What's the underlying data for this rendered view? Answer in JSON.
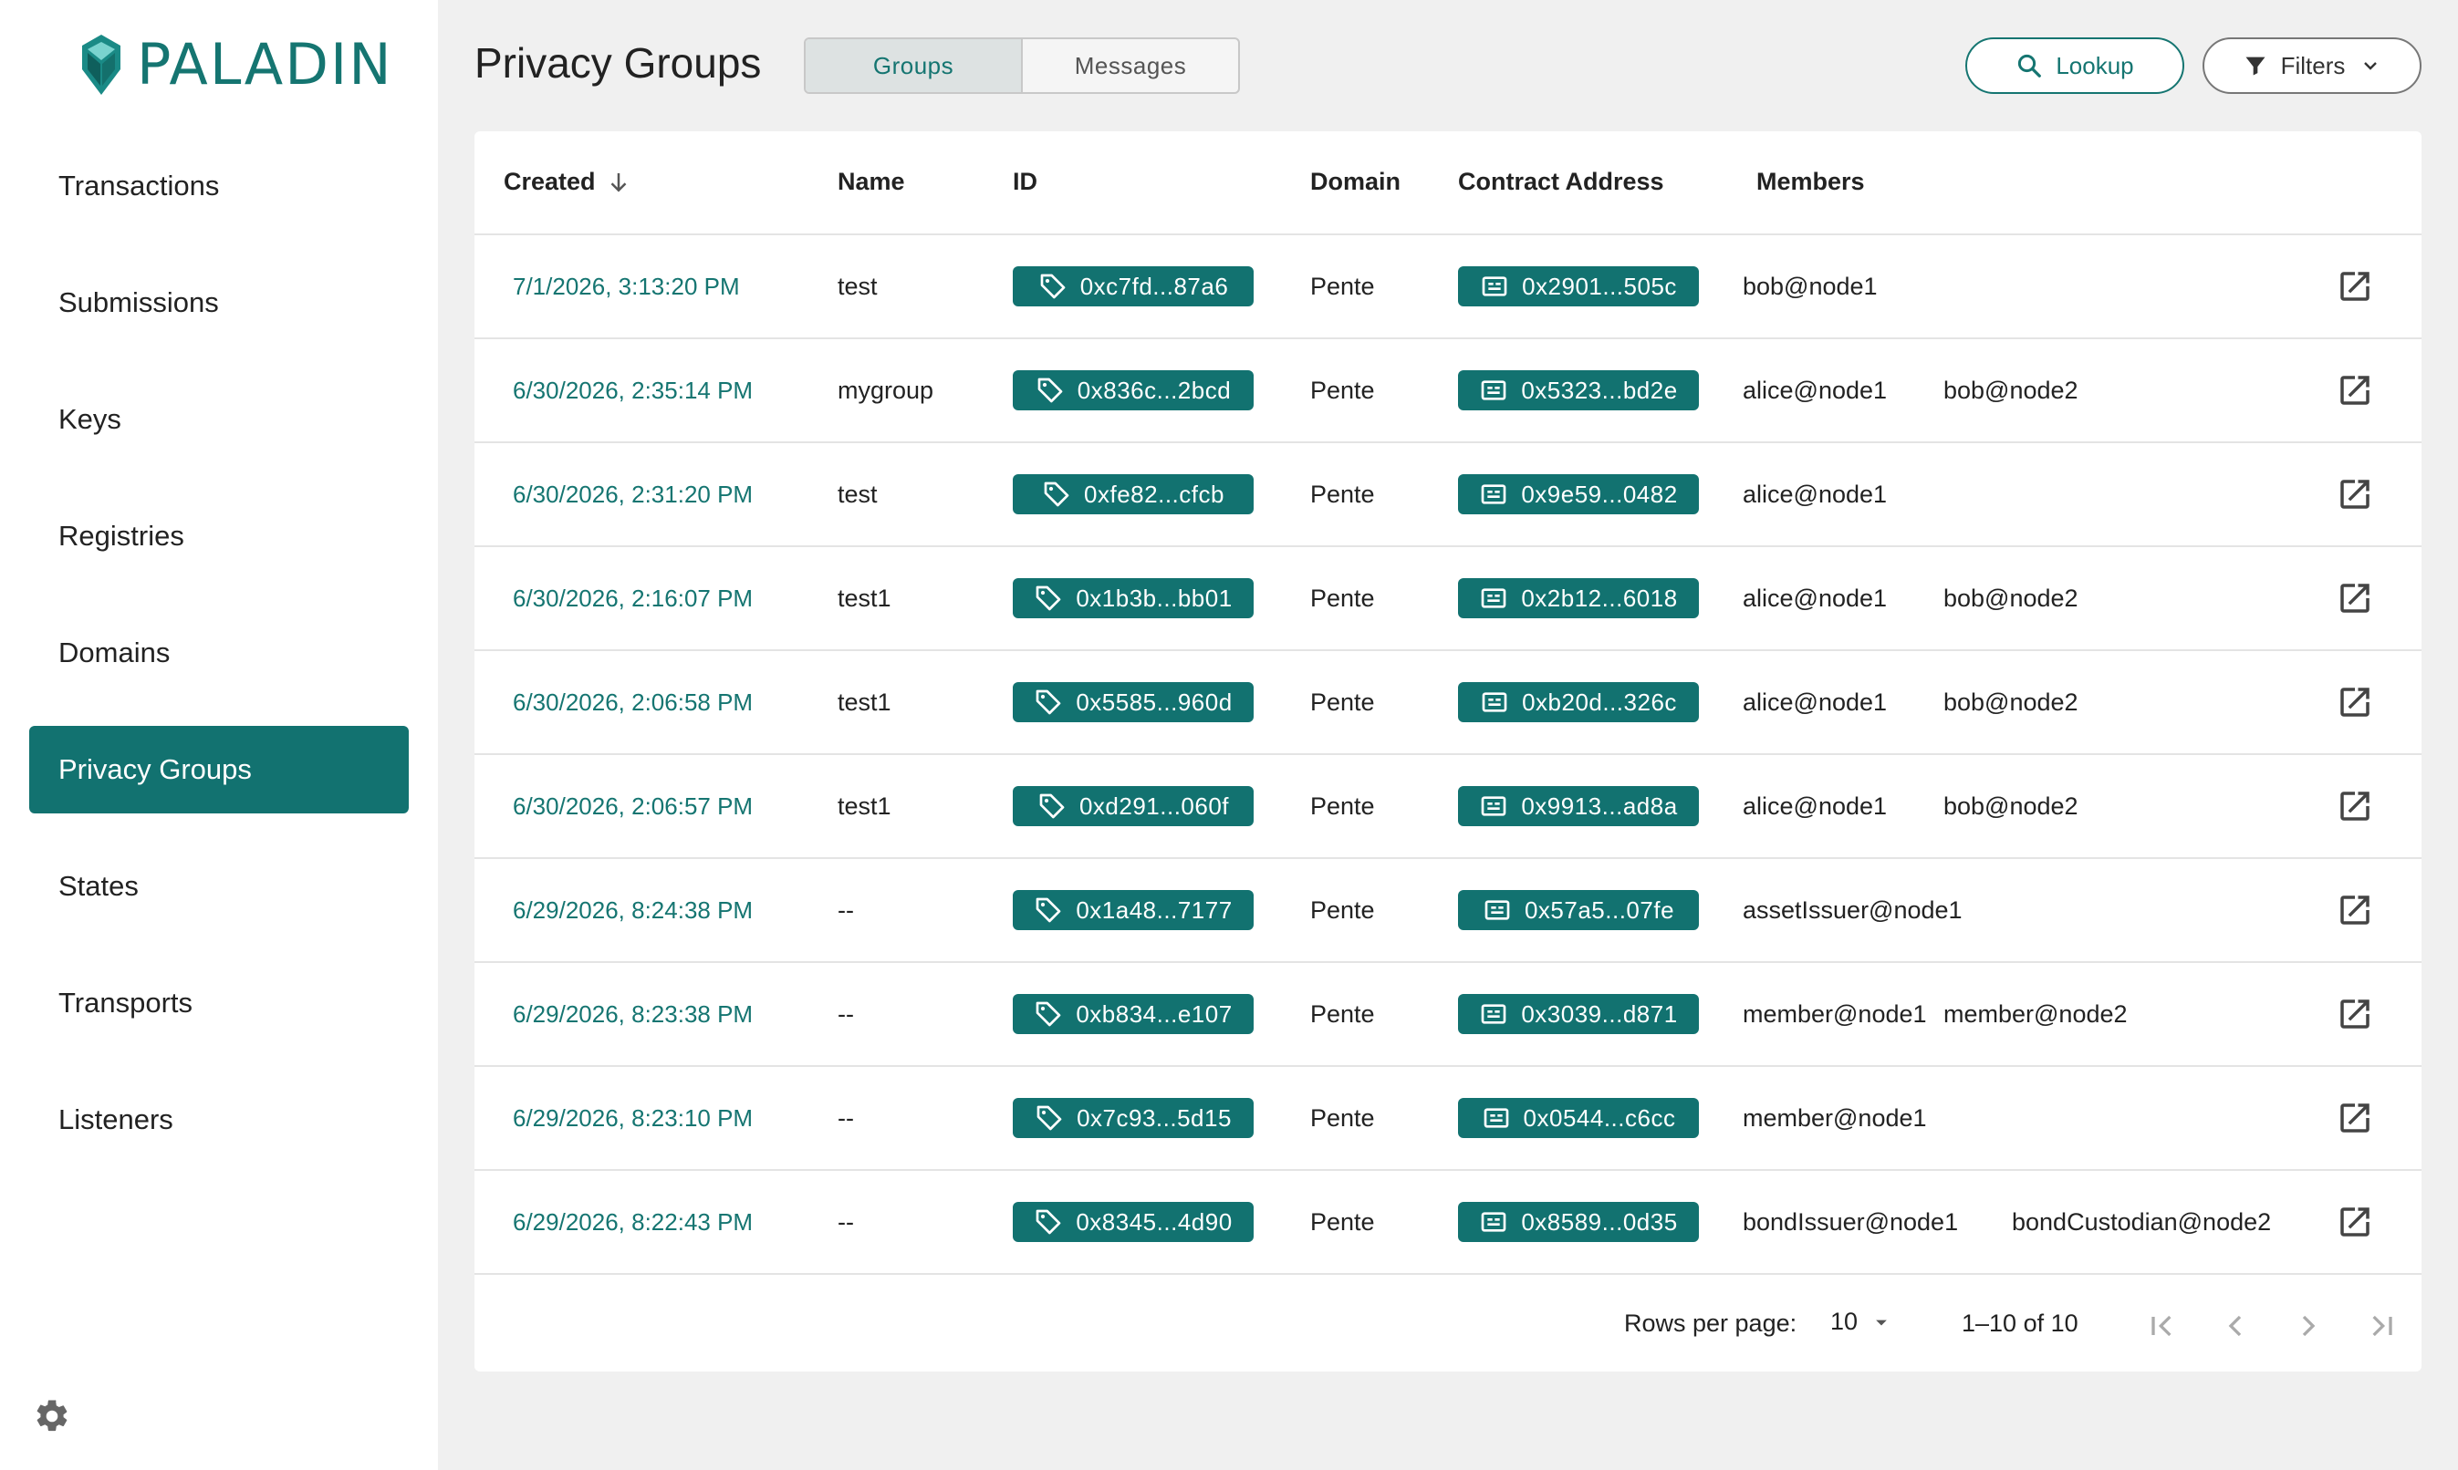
{
  "app": {
    "logo_text": "PALADIN",
    "accent": "#127270"
  },
  "sidebar": {
    "items": [
      {
        "label": "Transactions"
      },
      {
        "label": "Submissions"
      },
      {
        "label": "Keys"
      },
      {
        "label": "Registries"
      },
      {
        "label": "Domains"
      },
      {
        "label": "Privacy Groups",
        "active": true
      },
      {
        "label": "States"
      },
      {
        "label": "Transports"
      },
      {
        "label": "Listeners"
      }
    ],
    "settings_icon": "gear-icon"
  },
  "header": {
    "title": "Privacy Groups",
    "tabs": [
      {
        "label": "Groups",
        "active": true
      },
      {
        "label": "Messages"
      }
    ],
    "lookup_label": "Lookup",
    "filters_label": "Filters"
  },
  "table": {
    "columns": [
      "Created",
      "Name",
      "ID",
      "Domain",
      "Contract Address",
      "Members"
    ],
    "rows": [
      {
        "created": "7/1/2026, 3:13:20 PM",
        "name": "test",
        "id": "0xc7fd...87a6",
        "domain": "Pente",
        "contract": "0x2901...505c",
        "members": [
          "bob@node1"
        ]
      },
      {
        "created": "6/30/2026, 2:35:14 PM",
        "name": "mygroup",
        "id": "0x836c...2bcd",
        "domain": "Pente",
        "contract": "0x5323...bd2e",
        "members": [
          "alice@node1",
          "bob@node2"
        ]
      },
      {
        "created": "6/30/2026, 2:31:20 PM",
        "name": "test",
        "id": "0xfe82...cfcb",
        "domain": "Pente",
        "contract": "0x9e59...0482",
        "members": [
          "alice@node1"
        ]
      },
      {
        "created": "6/30/2026, 2:16:07 PM",
        "name": "test1",
        "id": "0x1b3b...bb01",
        "domain": "Pente",
        "contract": "0x2b12...6018",
        "members": [
          "alice@node1",
          "bob@node2"
        ]
      },
      {
        "created": "6/30/2026, 2:06:58 PM",
        "name": "test1",
        "id": "0x5585...960d",
        "domain": "Pente",
        "contract": "0xb20d...326c",
        "members": [
          "alice@node1",
          "bob@node2"
        ]
      },
      {
        "created": "6/30/2026, 2:06:57 PM",
        "name": "test1",
        "id": "0xd291...060f",
        "domain": "Pente",
        "contract": "0x9913...ad8a",
        "members": [
          "alice@node1",
          "bob@node2"
        ]
      },
      {
        "created": "6/29/2026, 8:24:38 PM",
        "name": "--",
        "id": "0x1a48...7177",
        "domain": "Pente",
        "contract": "0x57a5...07fe",
        "members": [
          "assetIssuer@node1"
        ]
      },
      {
        "created": "6/29/2026, 8:23:38 PM",
        "name": "--",
        "id": "0xb834...e107",
        "domain": "Pente",
        "contract": "0x3039...d871",
        "members": [
          "member@node1",
          "member@node2"
        ]
      },
      {
        "created": "6/29/2026, 8:23:10 PM",
        "name": "--",
        "id": "0x7c93...5d15",
        "domain": "Pente",
        "contract": "0x0544...c6cc",
        "members": [
          "member@node1"
        ]
      },
      {
        "created": "6/29/2026, 8:22:43 PM",
        "name": "--",
        "id": "0x8345...4d90",
        "domain": "Pente",
        "contract": "0x8589...0d35",
        "members": [
          "bondIssuer@node1",
          "bondCustodian@node2"
        ]
      }
    ]
  },
  "pagination": {
    "rows_per_page_label": "Rows per page:",
    "rows_per_page": "10",
    "range": "1–10 of 10"
  }
}
